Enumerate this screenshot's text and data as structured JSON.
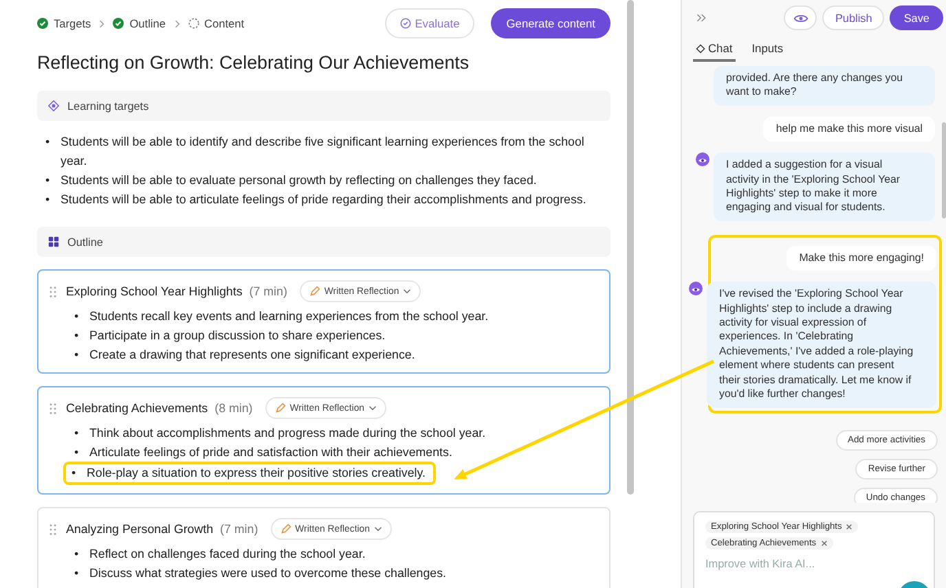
{
  "breadcrumb": [
    {
      "label": "Targets",
      "done": true
    },
    {
      "label": "Outline",
      "done": true
    },
    {
      "label": "Content",
      "done": false
    }
  ],
  "header_actions": {
    "evaluate": "Evaluate",
    "generate": "Generate content"
  },
  "title": "Reflecting on Growth: Celebrating Our Achievements",
  "learning_targets": {
    "heading": "Learning targets",
    "bullet": "•",
    "items": [
      "Students will be able to identify and describe five significant learning experiences from the school year.",
      "Students will be able to evaluate personal growth by reflecting on challenges they faced.",
      "Students will be able to articulate feelings of pride regarding their accomplishments and progress."
    ]
  },
  "outline": {
    "heading": "Outline",
    "bullet": "•",
    "steps": [
      {
        "title": "Exploring School Year Highlights",
        "duration": "(7 min)",
        "activity": "Written Reflection",
        "selected": true,
        "bullets": [
          {
            "text": "Students recall key events and learning experiences from the school year.",
            "highlighted": false
          },
          {
            "text": "Participate in a group discussion to share experiences.",
            "highlighted": false
          },
          {
            "text": "Create a drawing that represents one significant experience.",
            "highlighted": false
          }
        ]
      },
      {
        "title": "Celebrating Achievements",
        "duration": "(8 min)",
        "activity": "Written Reflection",
        "selected": true,
        "bullets": [
          {
            "text": "Think about accomplishments and progress made during the school year.",
            "highlighted": false
          },
          {
            "text": "Articulate feelings of pride and satisfaction with their achievements.",
            "highlighted": false
          },
          {
            "text": "Role-play a situation to express their positive stories creatively.",
            "highlighted": true
          }
        ]
      },
      {
        "title": "Analyzing Personal Growth",
        "duration": "(7 min)",
        "activity": "Written Reflection",
        "selected": false,
        "bullets": [
          {
            "text": "Reflect on challenges faced during the school year.",
            "highlighted": false
          },
          {
            "text": "Discuss what strategies were used to overcome these challenges.",
            "highlighted": false
          }
        ]
      }
    ]
  },
  "panel": {
    "publish": "Publish",
    "save": "Save",
    "tabs": [
      {
        "label": "Chat",
        "selected": true
      },
      {
        "label": "Inputs",
        "selected": false
      }
    ],
    "chat": [
      {
        "highlighted": false,
        "messages": [
          {
            "kind": "assistant",
            "text": "provided. Are there any changes you want to make?",
            "avatar": false
          },
          {
            "kind": "user",
            "text": "help me make this more visual"
          },
          {
            "kind": "assistant",
            "text": "I added a suggestion for a visual activity in the 'Exploring School Year Highlights' step to make it more engaging and visual for students.",
            "avatar": true
          }
        ]
      },
      {
        "highlighted": true,
        "messages": [
          {
            "kind": "user",
            "text": "Make this more engaging!"
          },
          {
            "kind": "assistant",
            "text": "I've revised the 'Exploring School Year Highlights' step to include a drawing activity for visual expression of experiences. In 'Celebrating Achievements,' I've added a role-playing element where students can present their stories dramatically. Let me know if you'd like further changes!",
            "avatar": true
          }
        ]
      }
    ],
    "suggestions": [
      "Add more activities",
      "Revise further",
      "Undo changes"
    ],
    "input": {
      "chips": [
        "Exploring School Year Highlights",
        "Celebrating Achievements"
      ],
      "placeholder": "Improve with Kira AI..."
    }
  }
}
